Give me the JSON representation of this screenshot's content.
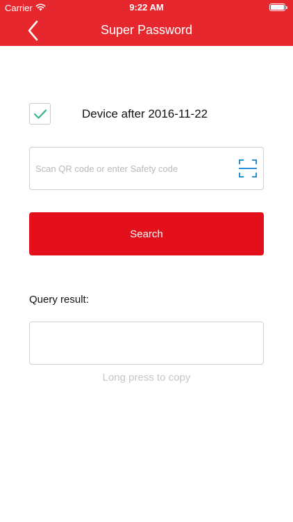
{
  "status_bar": {
    "carrier": "Carrier",
    "time": "9:22 AM",
    "battery_level": 1.0
  },
  "nav": {
    "title": "Super Password",
    "back_icon": "chevron-left-icon"
  },
  "device_option": {
    "label": "Device after 2016-11-22",
    "checked": true
  },
  "code_input": {
    "placeholder": "Scan QR code or enter Safety code",
    "value": "",
    "scan_icon": "qr-scan-icon"
  },
  "search_button": {
    "label": "Search"
  },
  "result": {
    "label": "Query result:",
    "value": "",
    "hint": "Long press to copy"
  },
  "colors": {
    "header": "#e6282e",
    "button": "#e3101b",
    "check": "#3bb08f",
    "scan_icon": "#2b8fd8"
  }
}
